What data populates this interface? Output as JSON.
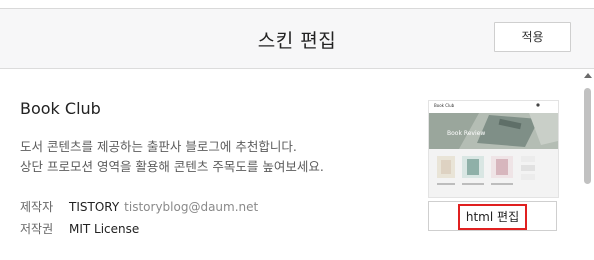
{
  "header": {
    "title": "스킨 편집",
    "apply_label": "적용"
  },
  "skin": {
    "name": "Book Club",
    "description_lines": [
      "도서 콘텐츠를 제공하는 출판사 블로그에 추천합니다.",
      "상단 프로모션 영역을 활용해 콘텐츠 주목도를 높여보세요."
    ],
    "maker_label": "제작자",
    "maker_name": "TISTORY",
    "maker_email": "tistoryblog@daum.net",
    "license_label": "저작권",
    "license_value": "MIT License"
  },
  "preview": {
    "logo_text": "Book Club",
    "banner_text": "Book Review"
  },
  "actions": {
    "html_edit_label": "html 편집"
  },
  "colors": {
    "header_bg": "#f7f7f8",
    "highlight_border": "#e02020",
    "scroll_thumb": "#c1c1c1"
  }
}
